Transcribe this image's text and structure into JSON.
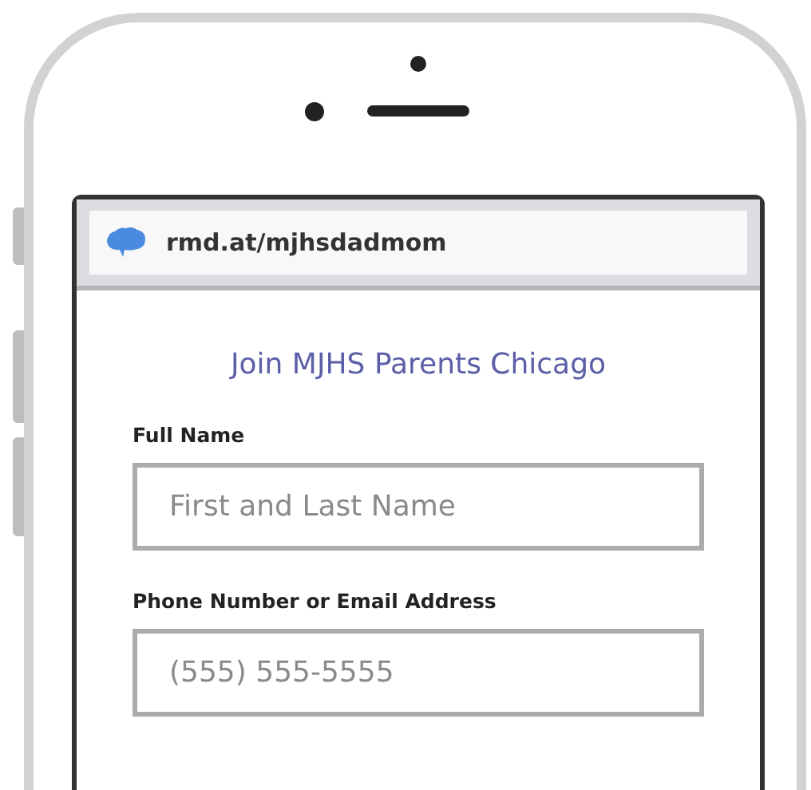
{
  "browser": {
    "url": "rmd.at/mjhsdadmom"
  },
  "form": {
    "title": "Join MJHS Parents Chicago",
    "fields": [
      {
        "label": "Full Name",
        "placeholder": "First and Last Name"
      },
      {
        "label": "Phone Number or Email Address",
        "placeholder": "(555) 555-5555"
      }
    ]
  }
}
